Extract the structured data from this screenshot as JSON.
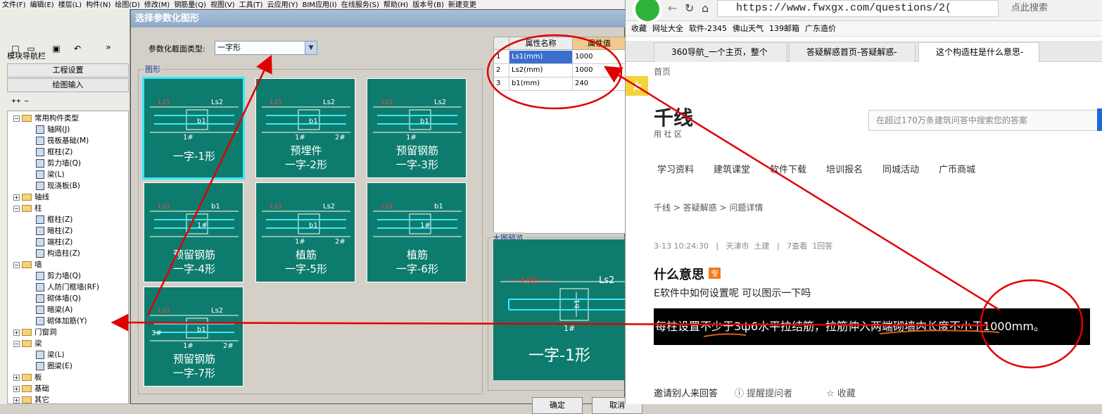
{
  "menubar": [
    "文件(F)",
    "编辑(E)",
    "楼层(L)",
    "构件(N)",
    "绘图(D)",
    "修改(M)",
    "钢筋量(Q)",
    "视图(V)",
    "工具(T)",
    "云应用(Y)",
    "BIM应用(I)",
    "在线服务(S)",
    "帮助(H)",
    "版本号(B)",
    "新建变更"
  ],
  "left_pane": {
    "nav_title": "模块导航栏",
    "project_settings": "工程设置",
    "drawing_input": "绘图输入",
    "tree": [
      {
        "label": "常用构件类型",
        "level": 1,
        "expander": "−",
        "folder": true
      },
      {
        "label": "轴网(J)",
        "level": 2
      },
      {
        "label": "筏板基础(M)",
        "level": 2
      },
      {
        "label": "框柱(Z)",
        "level": 2
      },
      {
        "label": "剪力墙(Q)",
        "level": 2
      },
      {
        "label": "梁(L)",
        "level": 2
      },
      {
        "label": "现浇板(B)",
        "level": 2
      },
      {
        "label": "轴线",
        "level": 1,
        "expander": "+",
        "folder": true
      },
      {
        "label": "柱",
        "level": 1,
        "expander": "−",
        "folder": true
      },
      {
        "label": "框柱(Z)",
        "level": 2
      },
      {
        "label": "暗柱(Z)",
        "level": 2
      },
      {
        "label": "端柱(Z)",
        "level": 2
      },
      {
        "label": "构造柱(Z)",
        "level": 2
      },
      {
        "label": "墙",
        "level": 1,
        "expander": "−",
        "folder": true
      },
      {
        "label": "剪力墙(Q)",
        "level": 2
      },
      {
        "label": "人防门框墙(RF)",
        "level": 2
      },
      {
        "label": "砌体墙(Q)",
        "level": 2
      },
      {
        "label": "暗梁(A)",
        "level": 2
      },
      {
        "label": "砌体加筋(Y)",
        "level": 2
      },
      {
        "label": "门窗洞",
        "level": 1,
        "expander": "+",
        "folder": true
      },
      {
        "label": "梁",
        "level": 1,
        "expander": "−",
        "folder": true
      },
      {
        "label": "梁(L)",
        "level": 2
      },
      {
        "label": "圈梁(E)",
        "level": 2
      },
      {
        "label": "板",
        "level": 1,
        "expander": "+",
        "folder": true
      },
      {
        "label": "基础",
        "level": 1,
        "expander": "+",
        "folder": true
      },
      {
        "label": "其它",
        "level": 1,
        "expander": "+",
        "folder": true
      }
    ]
  },
  "dialog": {
    "title": "选择参数化图形",
    "type_label": "参数化截面类型:",
    "type_value": "一字形",
    "group_label": "图形",
    "tiles": [
      {
        "line1": "",
        "line2": "一字-1形",
        "labels": [
          "Ls1",
          "Ls2",
          "b1",
          "1#"
        ]
      },
      {
        "line1": "预埋件",
        "line2": "一字-2形",
        "labels": [
          "Ls1",
          "Ls2",
          "b1",
          "1#",
          "2#"
        ]
      },
      {
        "line1": "预留钢筋",
        "line2": "一字-3形",
        "labels": [
          "Ls1",
          "Ls2",
          "b1",
          "1#"
        ]
      },
      {
        "line1": "预留钢筋",
        "line2": "一字-4形",
        "labels": [
          "Ls1",
          "b1",
          "1#"
        ]
      },
      {
        "line1": "植筋",
        "line2": "一字-5形",
        "labels": [
          "Ls1",
          "Ls2",
          "b1",
          "1#",
          "2#"
        ]
      },
      {
        "line1": "植筋",
        "line2": "一字-6形",
        "labels": [
          "Ls1",
          "b1",
          "1#"
        ]
      },
      {
        "line1": "预留钢筋",
        "line2": "一字-7形",
        "labels": [
          "Ls1",
          "Ls2",
          "b1",
          "1#",
          "2#",
          "3#"
        ]
      }
    ],
    "props": {
      "col_name": "属性名称",
      "col_value": "属性值",
      "rows": [
        {
          "idx": "1",
          "name": "Ls1(mm)",
          "value": "1000"
        },
        {
          "idx": "2",
          "name": "Ls2(mm)",
          "value": "1000"
        },
        {
          "idx": "3",
          "name": "b1(mm)",
          "value": "240"
        }
      ]
    },
    "preview_label": "大图预览",
    "preview": {
      "title": "一字-1形",
      "ls1": "Ls1",
      "ls2": "Ls2",
      "b1": "b1",
      "mark": "1#"
    },
    "ok": "确定",
    "cancel": "取消"
  },
  "browser": {
    "url": "https://www.fwxgx.com/questions/2(",
    "search_placeholder": "点此搜索",
    "bookmarks": [
      "收藏",
      "网址大全",
      "软件-2345",
      "佛山天气",
      "139邮箱",
      "广东造价"
    ],
    "tabs": [
      "360导航_一个主页，整个",
      "答疑解惑首页-答疑解惑-",
      "这个构造柱是什么意思-"
    ],
    "page": {
      "home_link": "首页",
      "logo_text": "千线",
      "logo_sub": "用 社 区",
      "search_placeholder": "在超过170万条建筑问答中搜索您的答案",
      "nav": [
        "学习资料",
        "建筑课堂",
        "软件下载",
        "培训报名",
        "同城活动",
        "广币商城"
      ],
      "breadcrumb": "千线 > 答疑解惑 > 问题详情",
      "meta": "3-13 10:24:30   |   天津市  土建   |   7查看  1回答",
      "title": "什么意思",
      "title_badge": "专",
      "subtitle": "E软件中如何设置呢 可以图示一下吗",
      "quote": "每柱设置不少于3ф6水平拉结筋，拉筋伸入两端砌墙内长度不小于1000mm。",
      "invite": "邀请别人来回答",
      "remind": "提醒提问者",
      "favorite": "收藏"
    }
  },
  "colors": {
    "accent": "#0d7c6e",
    "annotation": "#e00000",
    "select": "#38e8ff"
  }
}
